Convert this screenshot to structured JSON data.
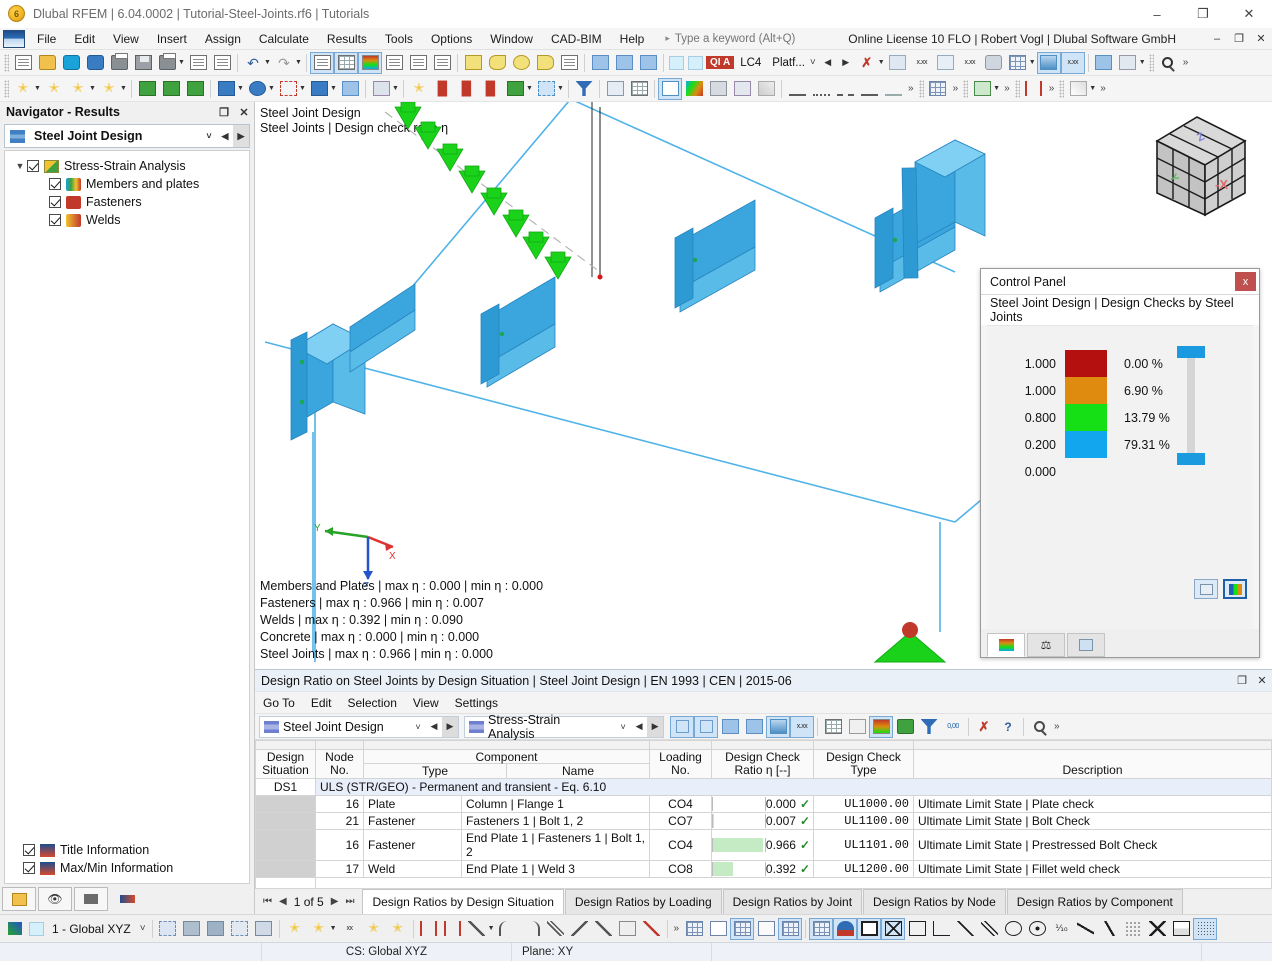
{
  "titlebar": {
    "title": "Dlubal RFEM | 6.04.0002 | Tutorial-Steel-Joints.rf6 | Tutorials",
    "minimize": "–",
    "restore": "❐",
    "close": "✕"
  },
  "menubar": {
    "items": [
      "File",
      "Edit",
      "View",
      "Insert",
      "Assign",
      "Calculate",
      "Results",
      "Tools",
      "Options",
      "Window",
      "CAD-BIM",
      "Help"
    ],
    "overflow": "▸",
    "search_placeholder": "Type a keyword (Alt+Q)",
    "search_value": "",
    "license": "Online License 10 FLO | Robert Vogl | Dlubal Software GmbH",
    "minimize": "–",
    "restore": "❐",
    "close": "✕"
  },
  "toolbar": {
    "qia_badge": "QI A",
    "load_case": "LC4",
    "platform": "Platf...",
    "overflow": "»"
  },
  "navigator": {
    "title": "Navigator - Results",
    "undock": "❐",
    "close": "✕",
    "combo_value": "Steel Joint Design",
    "tree": [
      {
        "label": "Stress-Strain Analysis",
        "checked": true,
        "expanded": true,
        "level": 0,
        "icon": "stress-strain-icon"
      },
      {
        "label": "Members and plates",
        "checked": true,
        "level": 1,
        "icon": "members-plates-icon"
      },
      {
        "label": "Fasteners",
        "checked": true,
        "level": 1,
        "icon": "fasteners-icon"
      },
      {
        "label": "Welds",
        "checked": true,
        "level": 1,
        "icon": "welds-icon"
      }
    ],
    "options": [
      {
        "label": "Title Information",
        "checked": true
      },
      {
        "label": "Max/Min Information",
        "checked": true
      }
    ]
  },
  "viewport": {
    "title_line1": "Steel Joint Design",
    "title_line2": "Steel Joints | Design check ratio η",
    "maxmin": [
      "Members and Plates | max η : 0.000 | min η : 0.000",
      "Fasteners | max η : 0.966 | min η : 0.007",
      "Welds | max η : 0.392 | min η : 0.090",
      "Concrete | max η : 0.000 | min η : 0.000",
      "Steel Joints | max η : 0.966 | min η : 0.000"
    ],
    "axis_labels": {
      "x": "X",
      "y": "Y",
      "z": "Z"
    },
    "viewcube_labels": {
      "front": "-X",
      "top": "Z",
      "side": "Y"
    }
  },
  "control_panel": {
    "title": "Control Panel",
    "close": "x",
    "subtitle": "Steel Joint Design | Design Checks by Steel Joints",
    "legend": {
      "values": [
        "1.000",
        "1.000",
        "0.800",
        "0.200",
        "0.000"
      ],
      "bands": [
        {
          "color": "#b51010",
          "percent": "0.00 %"
        },
        {
          "color": "#de8b10",
          "percent": "6.90 %"
        },
        {
          "color": "#15e015",
          "percent": "13.79 %"
        },
        {
          "color": "#11a6ee",
          "percent": "79.31 %"
        }
      ]
    },
    "actions": [
      "print-panel-icon",
      "color-scale-icon"
    ],
    "tabs": [
      "color-scale-tab",
      "factors-tab",
      "display-properties-tab"
    ]
  },
  "table_panel": {
    "title": "Design Ratio on Steel Joints by Design Situation | Steel Joint Design | EN 1993 | CEN | 2015-06",
    "undock": "❐",
    "close": "✕",
    "menu": [
      "Go To",
      "Edit",
      "Selection",
      "View",
      "Settings"
    ],
    "combo_left": "Steel Joint Design",
    "combo_right": "Stress-Strain Analysis",
    "columns": {
      "design_situation": "Design\nSituation",
      "node_no": "Node\nNo.",
      "component": "Component",
      "component_type": "Type",
      "component_name": "Name",
      "loading_no": "Loading\nNo.",
      "ratio": "Design Check",
      "ratio_sub": "Ratio η [--]",
      "check_type": "Design Check",
      "check_type_sub": "Type",
      "description": "Description"
    },
    "group_row": {
      "ds": "DS1",
      "text": "ULS (STR/GEO) - Permanent and transient - Eq. 6.10"
    },
    "rows": [
      {
        "node": "16",
        "type": "Plate",
        "name": "Column | Flange 1",
        "loading": "CO4",
        "ratio": "0.000",
        "ratio_pct": 0,
        "status": "✓",
        "check_type": "UL1000.00",
        "description": "Ultimate Limit State | Plate check"
      },
      {
        "node": "21",
        "type": "Fastener",
        "name": "Fasteners 1 | Bolt 1, 2",
        "loading": "CO7",
        "ratio": "0.007",
        "ratio_pct": 1,
        "status": "✓",
        "check_type": "UL1100.00",
        "description": "Ultimate Limit State | Bolt Check"
      },
      {
        "node": "16",
        "type": "Fastener",
        "name": "End Plate 1 | Fasteners 1 | Bolt 1, 2",
        "loading": "CO4",
        "ratio": "0.966",
        "ratio_pct": 97,
        "status": "✓",
        "check_type": "UL1101.00",
        "description": "Ultimate Limit State | Prestressed Bolt Check"
      },
      {
        "node": "17",
        "type": "Weld",
        "name": "End Plate 1 | Weld 3",
        "loading": "CO8",
        "ratio": "0.392",
        "ratio_pct": 39,
        "status": "✓",
        "check_type": "UL1200.00",
        "description": "Ultimate Limit State | Fillet weld check"
      }
    ],
    "pager": {
      "first": "⏮",
      "prev": "◀",
      "label": "1 of 5",
      "next": "▶",
      "last": "⏭"
    },
    "tabs": [
      {
        "label": "Design Ratios by Design Situation",
        "active": true
      },
      {
        "label": "Design Ratios by Loading",
        "active": false
      },
      {
        "label": "Design Ratios by Joint",
        "active": false
      },
      {
        "label": "Design Ratios by Node",
        "active": false
      },
      {
        "label": "Design Ratios by Component",
        "active": false
      }
    ]
  },
  "bottom_toolbar": {
    "cs_value": "1 - Global XYZ",
    "overflow": "»"
  },
  "statusbar": {
    "cs": "CS: Global XYZ",
    "plane": "Plane: XY"
  },
  "colors": {
    "accent": "#1c9ae0",
    "red": "#b51010",
    "orange": "#de8b10",
    "green": "#15e015",
    "blue": "#11a6ee",
    "ok_green": "#2a8a2a",
    "model_blue": "#3aa6dd",
    "model_green": "#19d219"
  }
}
